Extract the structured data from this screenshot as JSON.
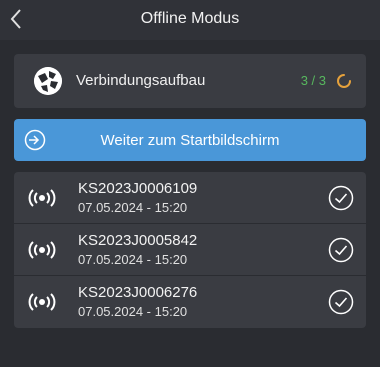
{
  "header": {
    "title": "Offline Modus",
    "back_icon": "chevron-left-icon"
  },
  "connection": {
    "icon": "globe-network-icon",
    "label": "Verbindungsaufbau",
    "count": "3 / 3",
    "count_color": "#57b85e",
    "spinner_icon": "loading-spinner-icon",
    "spinner_color": "#e6a23c"
  },
  "continue_button": {
    "icon": "login-arrow-icon",
    "label": "Weiter zum Startbildschirm",
    "color": "#4a97d8"
  },
  "devices": [
    {
      "id": "KS2023J0006109",
      "timestamp": "07.05.2024 - 15:20",
      "status_icon": "check-circle-icon"
    },
    {
      "id": "KS2023J0005842",
      "timestamp": "07.05.2024 - 15:20",
      "status_icon": "check-circle-icon"
    },
    {
      "id": "KS2023J0006276",
      "timestamp": "07.05.2024 - 15:20",
      "status_icon": "check-circle-icon"
    }
  ]
}
